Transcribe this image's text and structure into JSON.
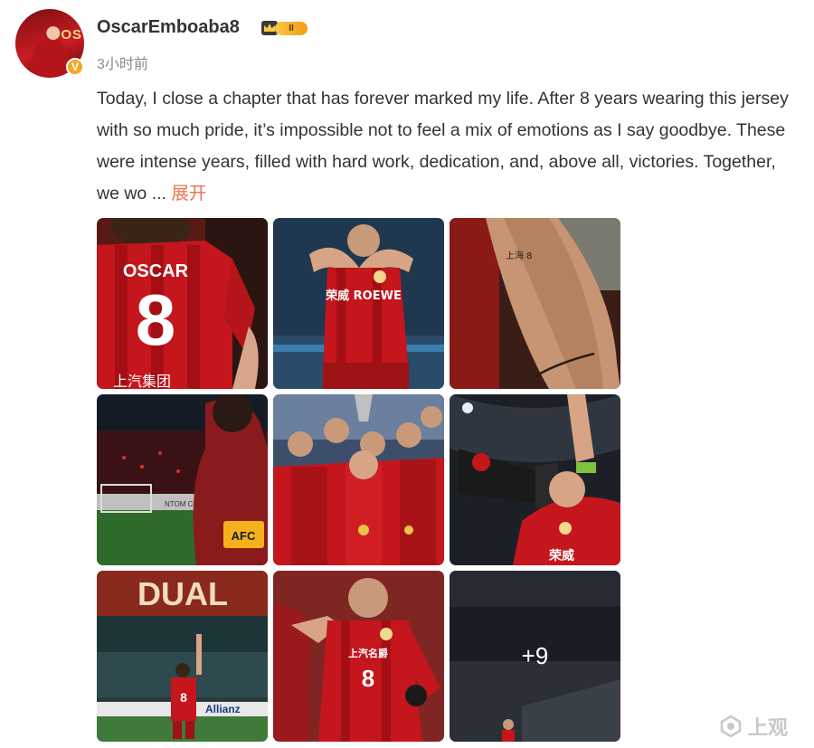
{
  "post": {
    "author": {
      "name": "OscarEmboaba8",
      "avatar_jersey_text": "OS",
      "verified_badge": "V",
      "level_badge": "II"
    },
    "timestamp": "3小时前",
    "text": "Today, I close a chapter that has forever marked my life. After 8 years wearing this jersey with so much pride, it’s impossible not to feel a mix of emotions as I say goodbye. These were intense years, filled with hard work, dedication, and, above all, victories. Together, we wo  ... ",
    "expand_label": "展开",
    "photos": [
      {
        "name": "jersey-back-number-8",
        "jersey_name": "OSCAR",
        "jersey_number": "8",
        "sponsor": "上汽集团"
      },
      {
        "name": "heart-hands-celebration",
        "sponsor": "荣威 ROEWE"
      },
      {
        "name": "forearm-tattoo",
        "tattoo_text": "上海 8"
      },
      {
        "name": "stadium-captain-armband",
        "armband": "AFC",
        "board_text": "NTOM CO."
      },
      {
        "name": "team-trophy-celebration"
      },
      {
        "name": "megaphone-celebration",
        "sponsor": "荣威"
      },
      {
        "name": "stadium-wave",
        "board_text": "Allianz"
      },
      {
        "name": "running-celebration",
        "jersey_number": "8",
        "sponsor": "上汽名爵"
      },
      {
        "name": "more-photos",
        "more_count": "+9"
      }
    ],
    "accent_color": "#eb7350"
  },
  "watermark": {
    "text": "上观"
  }
}
